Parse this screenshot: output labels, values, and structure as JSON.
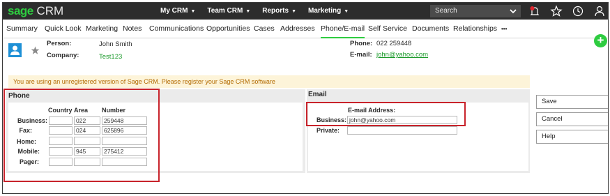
{
  "app": {
    "logo_brand": "sage",
    "logo_product": "CRM"
  },
  "top_menu": [
    {
      "label": "My CRM"
    },
    {
      "label": "Team CRM"
    },
    {
      "label": "Reports"
    },
    {
      "label": "Marketing"
    }
  ],
  "search": {
    "placeholder": "Search"
  },
  "tabs": [
    {
      "label": "Summary"
    },
    {
      "label": "Quick Look"
    },
    {
      "label": "Marketing"
    },
    {
      "label": "Notes"
    },
    {
      "label": "Communications"
    },
    {
      "label": "Opportunities"
    },
    {
      "label": "Cases"
    },
    {
      "label": "Addresses"
    },
    {
      "label": "Phone/E-mail",
      "active": true
    },
    {
      "label": "Self Service"
    },
    {
      "label": "Documents"
    },
    {
      "label": "Relationships"
    },
    {
      "label": "•••"
    }
  ],
  "header": {
    "person_label": "Person:",
    "person_value": "John Smith",
    "company_label": "Company:",
    "company_value": "Test123",
    "phone_label": "Phone:",
    "phone_value": "022 259448",
    "email_label": "E-mail:",
    "email_value": "john@yahoo.com"
  },
  "notice": "You are using an unregistered version of Sage CRM. Please register your Sage CRM software",
  "phone_section": {
    "title": "Phone",
    "columns": [
      "Country",
      "Area",
      "Number"
    ],
    "rows": [
      {
        "label": "Business:",
        "country": "",
        "area": "022",
        "number": "259448"
      },
      {
        "label": "Fax:",
        "country": "",
        "area": "024",
        "number": "625896"
      },
      {
        "label": "Home:",
        "country": "",
        "area": "",
        "number": ""
      },
      {
        "label": "Mobile:",
        "country": "",
        "area": "945",
        "number": "275412"
      },
      {
        "label": "Pager:",
        "country": "",
        "area": "",
        "number": ""
      }
    ]
  },
  "email_section": {
    "title": "Email",
    "column": "E-mail Address:",
    "rows": [
      {
        "label": "Business:",
        "value": "john@yahoo.com"
      },
      {
        "label": "Private:",
        "value": ""
      }
    ]
  },
  "actions": [
    {
      "label": "Save"
    },
    {
      "label": "Cancel"
    },
    {
      "label": "Help"
    }
  ],
  "colors": {
    "accent": "#2ecc40",
    "topbar": "#2d2d2d",
    "highlight": "#c8232b",
    "notice_bg": "#fdf4d9",
    "notice_text": "#b26a00"
  }
}
